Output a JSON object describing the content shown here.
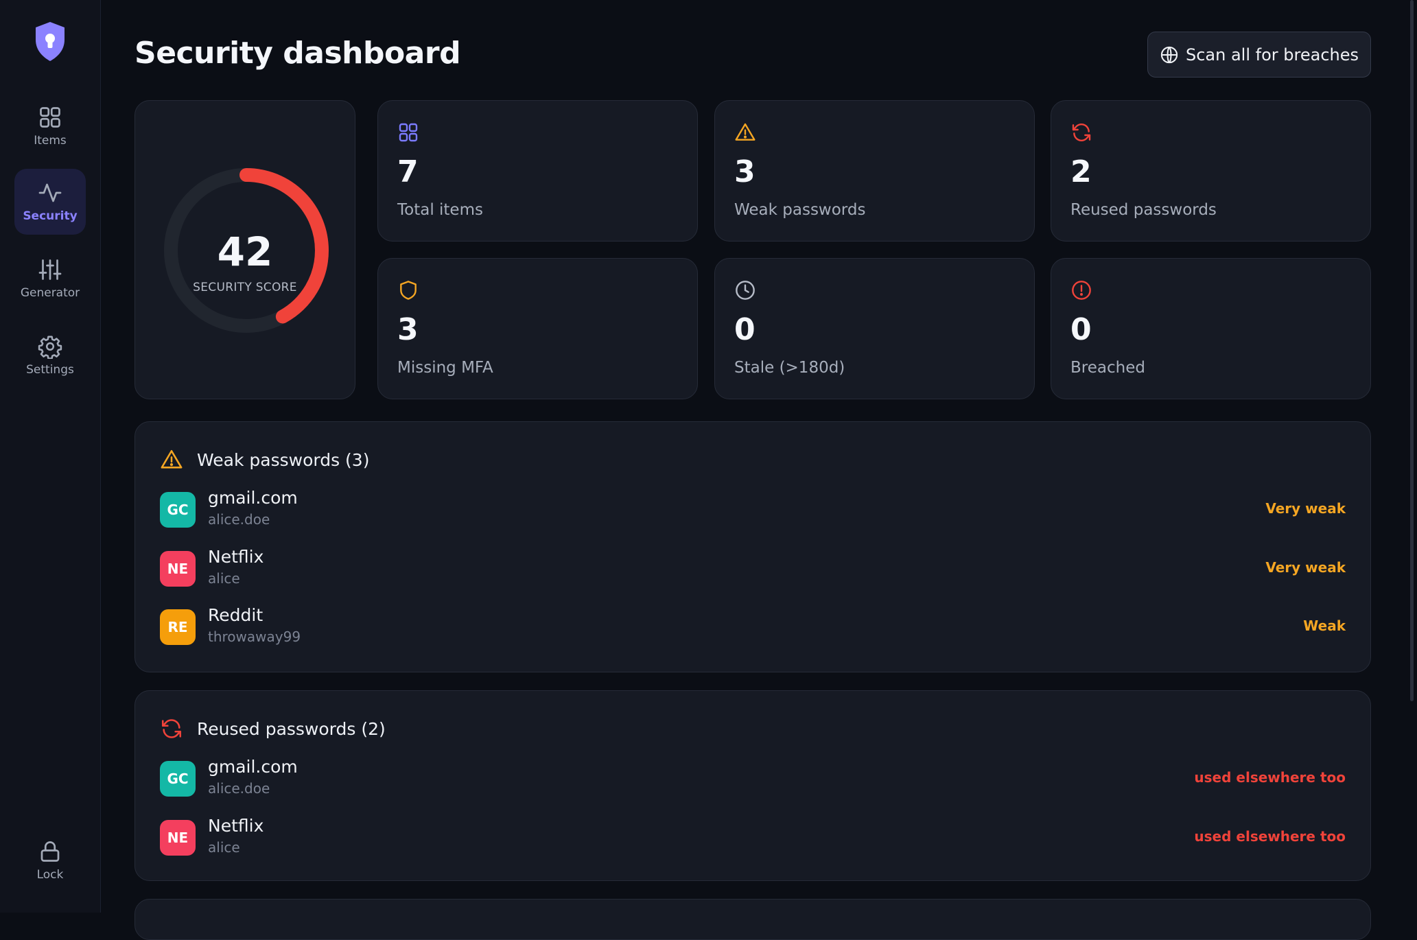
{
  "sidebar": {
    "items": [
      {
        "label": "Items",
        "icon": "grid-icon"
      },
      {
        "label": "Security",
        "icon": "activity-icon",
        "active": true
      },
      {
        "label": "Generator",
        "icon": "sliders-icon"
      },
      {
        "label": "Settings",
        "icon": "gear-icon"
      }
    ],
    "lock_label": "Lock"
  },
  "header": {
    "title": "Security dashboard",
    "scan_button": "Scan all for breaches"
  },
  "score": {
    "value": "42",
    "label": "SECURITY SCORE",
    "fraction": 0.42,
    "color": "#f0433a"
  },
  "stats": [
    {
      "value": "7",
      "label": "Total items",
      "icon": "grid-icon",
      "color": "#7b7bff"
    },
    {
      "value": "3",
      "label": "Weak passwords",
      "icon": "warning-icon",
      "color": "#f5a623"
    },
    {
      "value": "2",
      "label": "Reused passwords",
      "icon": "refresh-icon",
      "color": "#f0433a"
    },
    {
      "value": "3",
      "label": "Missing MFA",
      "icon": "shield-icon",
      "color": "#f5a623"
    },
    {
      "value": "0",
      "label": "Stale (>180d)",
      "icon": "clock-icon",
      "color": "#b6bcc8"
    },
    {
      "value": "0",
      "label": "Breached",
      "icon": "alert-circle-icon",
      "color": "#f0433a"
    }
  ],
  "weak": {
    "title": "Weak passwords (3)",
    "items": [
      {
        "initials": "GC",
        "name": "gmail.com",
        "user": "alice.doe",
        "tag": "Very weak",
        "color": "#14b8a6"
      },
      {
        "initials": "NE",
        "name": "Netflix",
        "user": "alice",
        "tag": "Very weak",
        "color": "#f43f5e"
      },
      {
        "initials": "RE",
        "name": "Reddit",
        "user": "throwaway99",
        "tag": "Weak",
        "color": "#f59e0b"
      }
    ]
  },
  "reused": {
    "title": "Reused passwords (2)",
    "items": [
      {
        "initials": "GC",
        "name": "gmail.com",
        "user": "alice.doe",
        "tag": "used elsewhere too",
        "color": "#14b8a6"
      },
      {
        "initials": "NE",
        "name": "Netflix",
        "user": "alice",
        "tag": "used elsewhere too",
        "color": "#f43f5e"
      }
    ]
  },
  "colors": {
    "accent": "#8b82ff",
    "warning": "#f5a623",
    "danger": "#f0433a"
  }
}
